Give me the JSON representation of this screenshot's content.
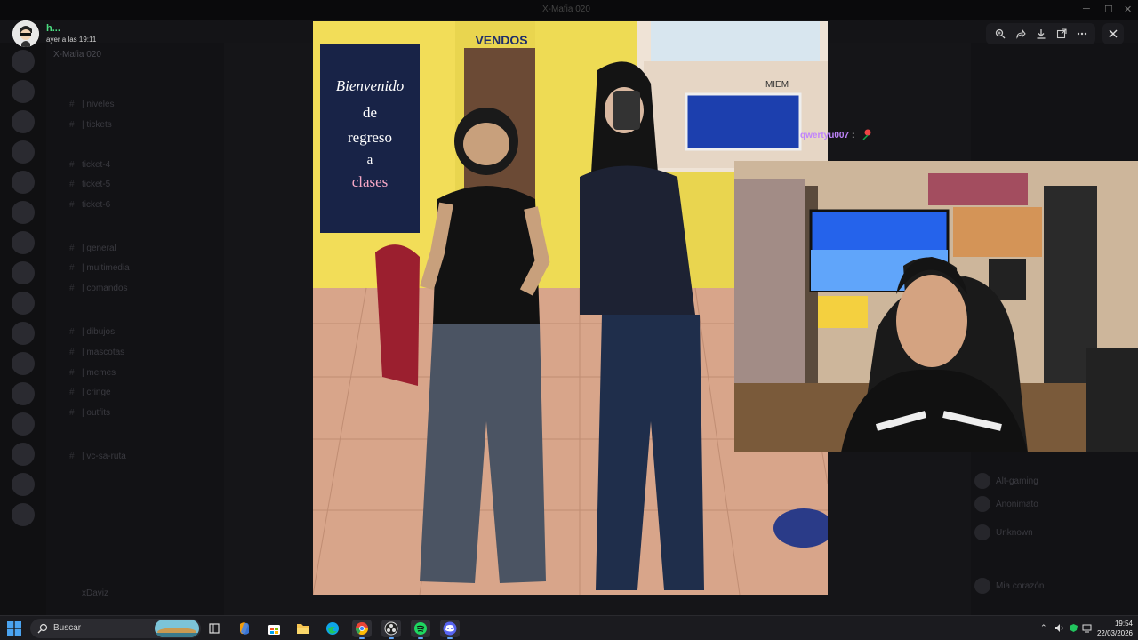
{
  "window": {
    "title": "X-Mafia 020"
  },
  "server": {
    "name": "X-Mafia 020"
  },
  "channels": [
    {
      "label": "| niveles"
    },
    {
      "label": "| tickets"
    },
    {
      "label": "ticket-4"
    },
    {
      "label": "ticket-5"
    },
    {
      "label": "ticket-6"
    },
    {
      "label": "| general"
    },
    {
      "label": "| multimedia"
    },
    {
      "label": "| comandos"
    },
    {
      "label": "| dibujos"
    },
    {
      "label": "| mascotas"
    },
    {
      "label": "| memes"
    },
    {
      "label": "| cringe"
    },
    {
      "label": "| outfits"
    },
    {
      "label": "| vc-sa-ruta"
    }
  ],
  "user_panel": {
    "name": "xDaviz"
  },
  "members": [
    {
      "name": "Alt-gaming"
    },
    {
      "name": "Anonimato"
    },
    {
      "name": "Unknown"
    },
    {
      "name": "Mia corazón"
    }
  ],
  "uploader": {
    "name": "h...",
    "timestamp": "ayer a las 19:11"
  },
  "viewer_toolbar": {
    "icons": [
      "zoom-icon",
      "share-icon",
      "download-icon",
      "open-external-icon",
      "more-icon"
    ],
    "close_icon": "close-icon"
  },
  "photo": {
    "poster_text": [
      "Bienvenido",
      "de",
      "regreso",
      "a",
      "clases"
    ],
    "banner_text": "VENDOS",
    "plaque_text": "MIEM"
  },
  "stream_chat": {
    "user": "qwertyu007",
    "separator": ":",
    "emote": "rose-emote"
  },
  "taskbar": {
    "search_placeholder": "Buscar",
    "apps": [
      "task-view-icon",
      "copilot-icon",
      "store-icon",
      "file-explorer-icon",
      "edge-icon",
      "chrome-icon",
      "obs-icon",
      "spotify-icon",
      "discord-icon"
    ],
    "time": "19:54",
    "date": "22/03/2026"
  },
  "colors": {
    "accent": "#c084fc",
    "online": "#4ade80",
    "taskbar": "#1b1b1f"
  }
}
